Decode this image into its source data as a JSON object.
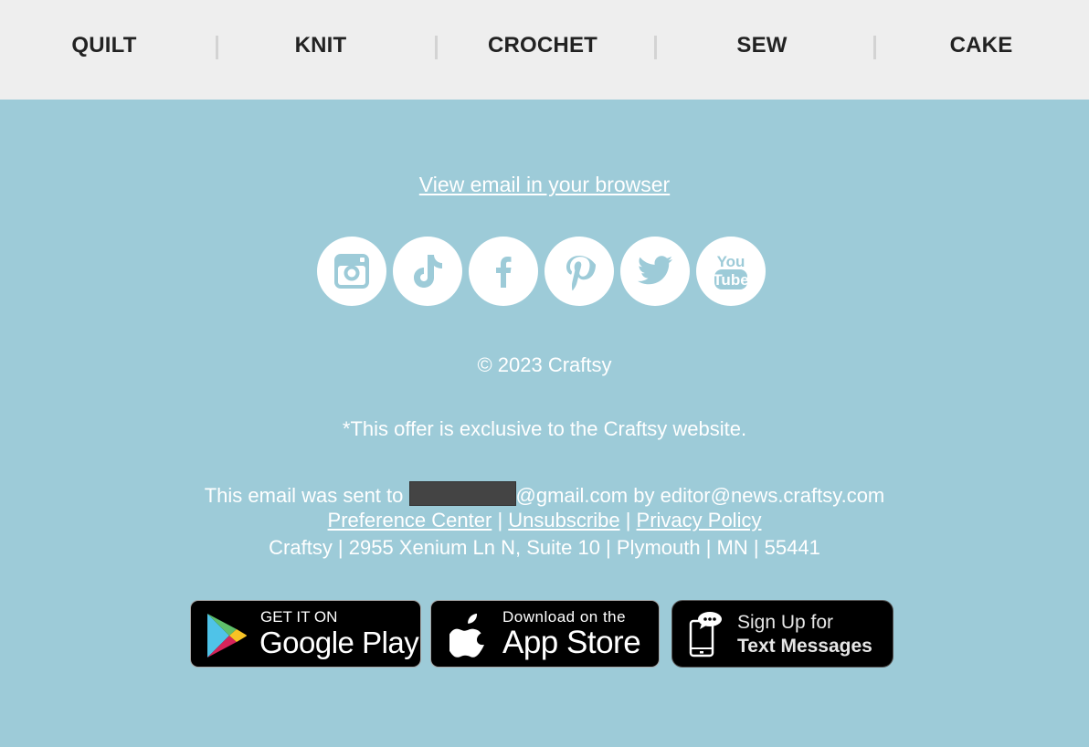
{
  "nav": {
    "items": [
      {
        "label": "QUILT"
      },
      {
        "label": "KNIT"
      },
      {
        "label": "CROCHET"
      },
      {
        "label": "SEW"
      },
      {
        "label": "CAKE"
      }
    ]
  },
  "footer": {
    "view_in_browser": "View email in your browser",
    "social": [
      {
        "name": "instagram"
      },
      {
        "name": "tiktok"
      },
      {
        "name": "facebook"
      },
      {
        "name": "pinterest"
      },
      {
        "name": "twitter"
      },
      {
        "name": "youtube",
        "line1": "You",
        "line2": "Tube"
      }
    ],
    "copyright": "© 2023 Craftsy",
    "offer_note": "*This offer is exclusive to the Craftsy website.",
    "sent_to_prefix": "This email was sent to",
    "sent_to_domain": "@gmail.com",
    "sent_by_prefix": "by",
    "sender": "editor@news.craftsy.com",
    "links": {
      "preference_center": "Preference Center",
      "unsubscribe": "Unsubscribe",
      "privacy_policy": "Privacy Policy",
      "separator": "|"
    },
    "address": "Craftsy | 2955 Xenium Ln N, Suite 10 | Plymouth | MN | 55441",
    "badges": {
      "google_play": {
        "small": "GET IT ON",
        "big": "Google Play"
      },
      "app_store": {
        "small": "Download on the",
        "big": "App Store"
      },
      "text_messages": {
        "small": "Sign Up for",
        "big": "Text Messages"
      }
    }
  },
  "colors": {
    "nav_bg": "#eeeeee",
    "footer_bg": "#9dcbd8",
    "icon_glyph": "#9dcbd8"
  }
}
